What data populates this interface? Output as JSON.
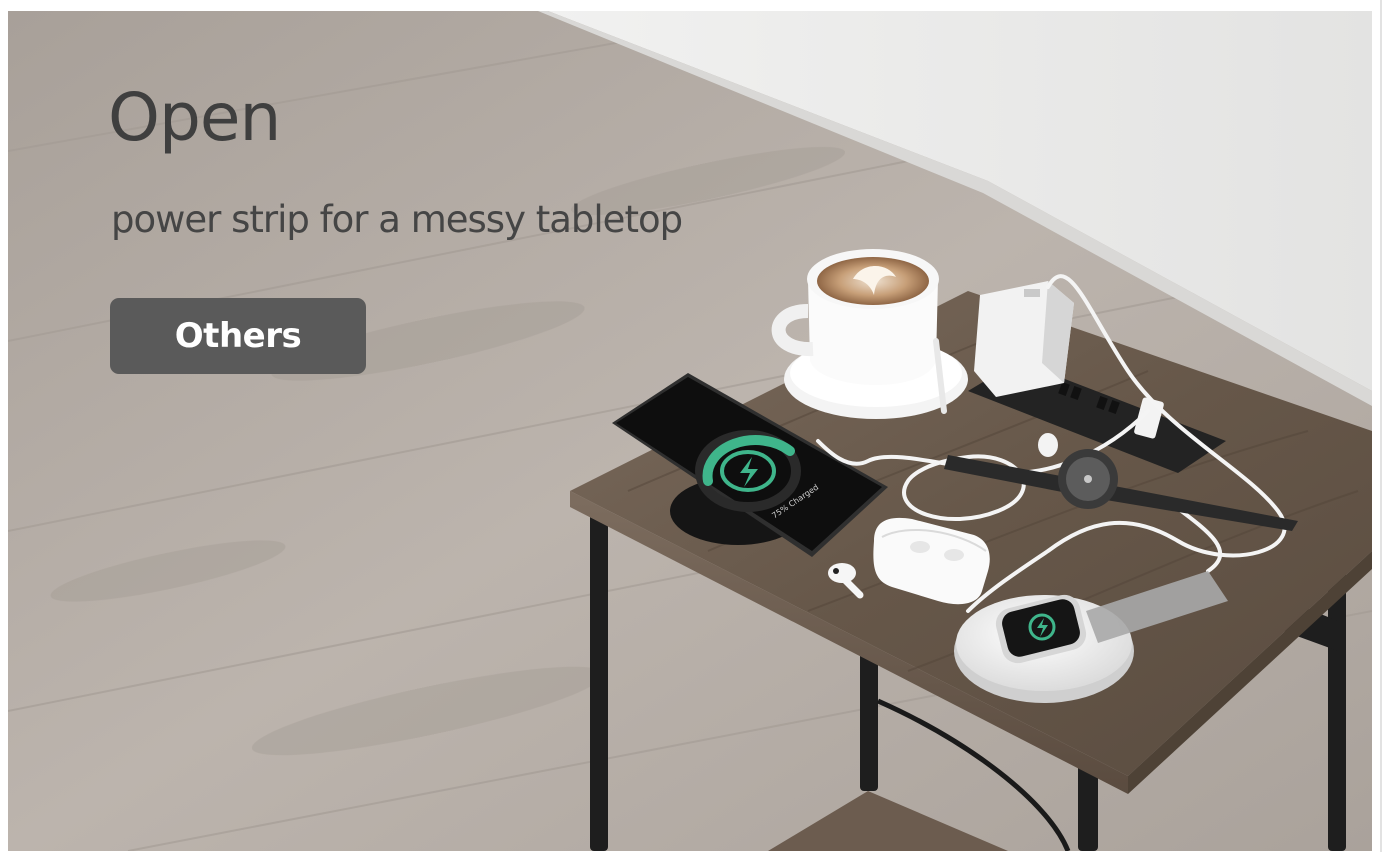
{
  "banner": {
    "headline": "Open",
    "subhead": "power strip for a messy tabletop",
    "cta_label": "Others"
  },
  "photo": {
    "phone_screen_text": "75% Charged",
    "icons": [
      "lightning-bolt-icon"
    ]
  },
  "colors": {
    "floor": "#b6aea7",
    "wall": "#ececec",
    "tabletop": "#6e5f52",
    "button": "#5a5a5a",
    "charge_ring": "#3fb58b",
    "headline_text": "#3f3f3f"
  }
}
